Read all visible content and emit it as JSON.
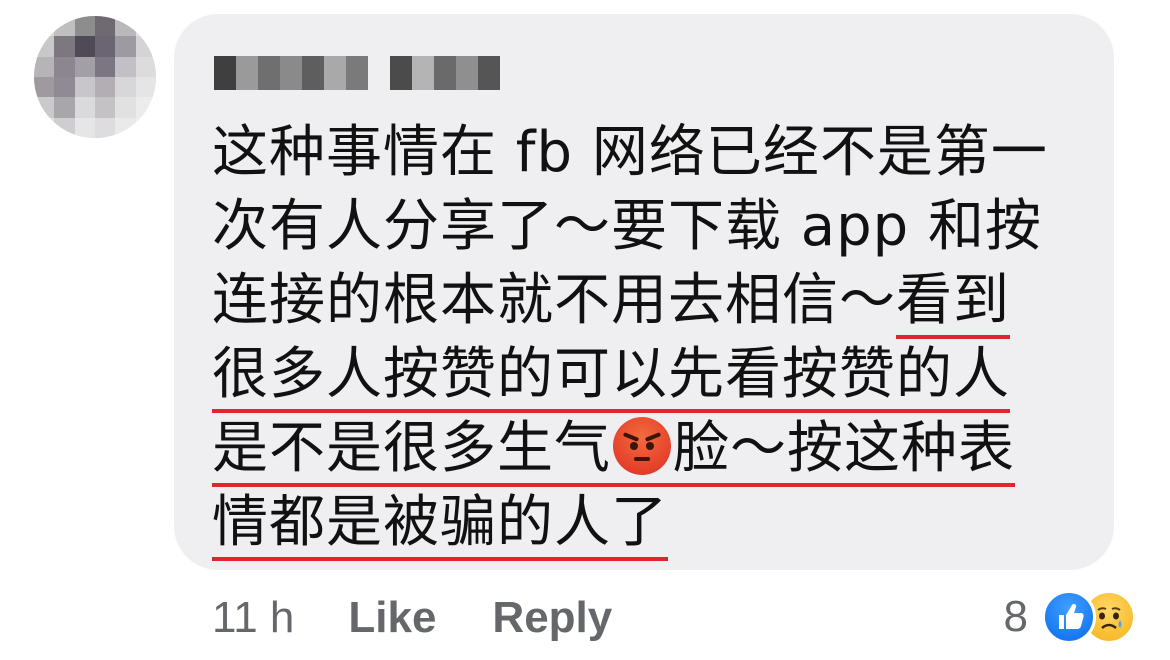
{
  "comment": {
    "text_lines": [
      "这种事情在 fb 网络已经不是第一",
      "次有人分享了～要下载 app 和按",
      "连接的根本就不用去相信～",
      "看到",
      "很多人按赞的可以先看按赞的人",
      "是不是很多生气",
      "脸～按这种表",
      "情都是被骗的人了"
    ],
    "emoji": "angry-face"
  },
  "actions": {
    "time": "11 h",
    "like_label": "Like",
    "reply_label": "Reply"
  },
  "reactions": {
    "count": "8",
    "types": [
      "like",
      "sad"
    ]
  },
  "colors": {
    "bubble": "#efeff2",
    "underline": "#e0262c",
    "meta_text": "#65676b",
    "like_blue": "#1877f2",
    "sad_yellow": "#f7b928"
  }
}
